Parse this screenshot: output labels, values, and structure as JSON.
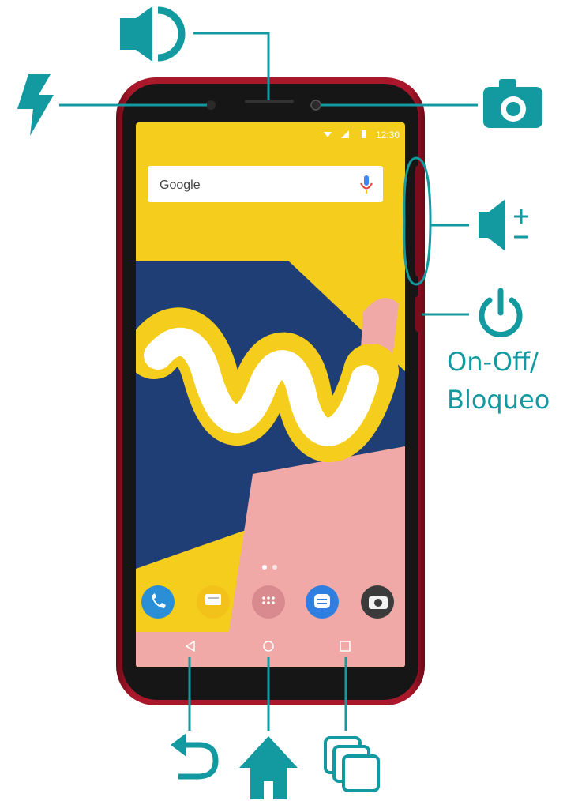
{
  "colors": {
    "teal": "#129aa0",
    "phone_body": "#8e1020",
    "bezel": "#1a1a1a",
    "wallpaper_yellow": "#f5cd1c",
    "wallpaper_blue": "#1f3e75",
    "wallpaper_pink": "#f0a9a6"
  },
  "status_bar": {
    "time": "12:30"
  },
  "search_bar": {
    "logo": "Google"
  },
  "power_label": {
    "line1": "On-Off/",
    "line2": "Bloqueo"
  },
  "icons": {
    "flash": "flash-icon",
    "earpiece": "speaker-icon",
    "front_camera": "camera-icon",
    "volume": "volume-icon",
    "power": "power-icon",
    "back": "back-arrow-icon",
    "home": "home-icon",
    "recents": "recents-icon"
  }
}
